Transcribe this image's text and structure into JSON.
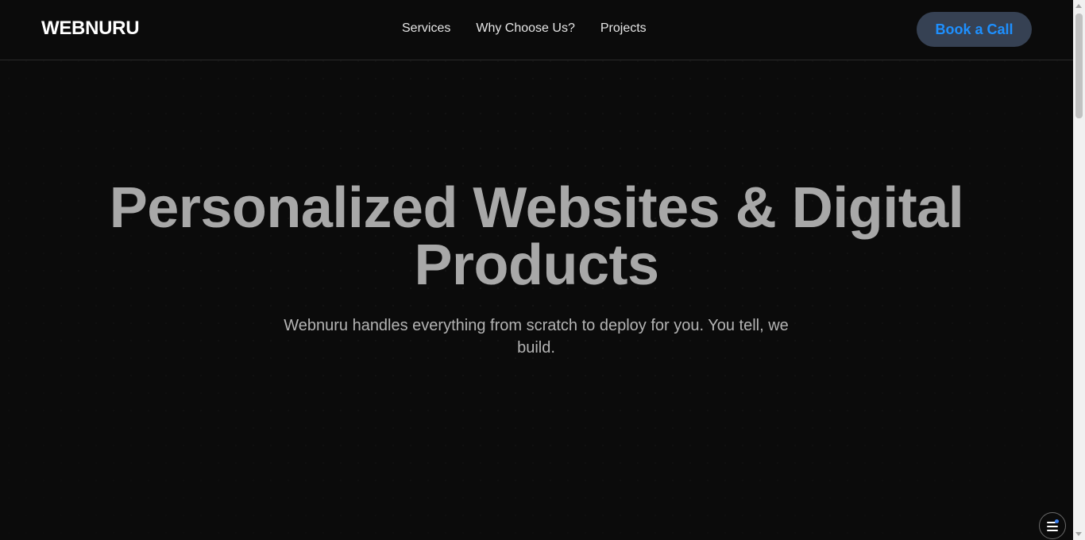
{
  "header": {
    "logo": "WEBNURU",
    "nav": [
      {
        "label": "Services"
      },
      {
        "label": "Why Choose Us?"
      },
      {
        "label": "Projects"
      }
    ],
    "cta_label": "Book a Call"
  },
  "hero": {
    "title_line1": "Personalized Websites & Digital",
    "title_line2": "Products",
    "subtitle": "Webnuru handles everything from scratch to deploy for you. You tell, we build."
  },
  "widget": {
    "icon": "menu-icon"
  },
  "colors": {
    "background": "#0b0b0b",
    "cta_bg": "#364153",
    "cta_text": "#1e90ff",
    "title": "#a8a8a8",
    "widget_dot": "#3b82f6"
  }
}
